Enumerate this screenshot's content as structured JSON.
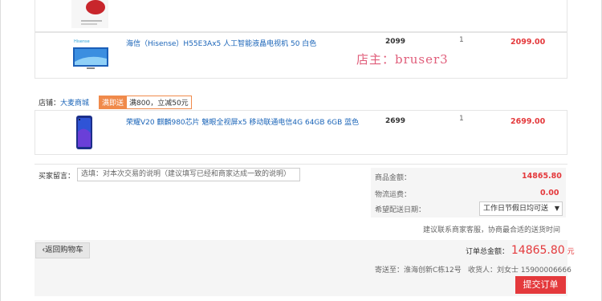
{
  "colors": {
    "accent": "#e4393c",
    "link": "#1a64b8",
    "promo": "#f08a4b",
    "border": "#e5e5e5"
  },
  "items": [
    {
      "name": "海信（Hisense）H55E3Ax5 人工智能液晶电视机 50 白色",
      "price": "2099",
      "qty": "1",
      "subtotal": "2099.00"
    },
    {
      "name": "荣耀V20 麒麟980芯片 魅眼全视屏x5 移动联通电信4G 64GB 6GB 蓝色",
      "price": "2699",
      "qty": "1",
      "subtotal": "2699.00"
    }
  ],
  "watermark": "店主：bruser3",
  "shop": {
    "label": "店铺：",
    "name": "大麦商城",
    "promo_tag": "满即送",
    "promo_text": "满800，立减50元"
  },
  "note": {
    "label": "买家留言：",
    "placeholder": "选填：对本次交易的说明（建议填写已经和商家达成一致的说明）"
  },
  "summary": {
    "goods_label": "商品金额：",
    "goods_value": "14865.80",
    "ship_label": "物流运费：",
    "ship_value": "0.00",
    "date_label": "希望配送日期：",
    "date_value": "工作日节假日均可送",
    "hint": "建议联系商家客服，协商最合适的送货时间"
  },
  "footer": {
    "back_label": "返回购物车",
    "total_label": "订单总金额：",
    "total_value": "14865.80",
    "total_unit": "元",
    "ship_to_label": "寄送至：",
    "ship_to_value": "淮海创新C栋12号",
    "receiver_label": "收货人：",
    "receiver_value": "刘女士 15900006666",
    "submit_label": "提交订单"
  }
}
